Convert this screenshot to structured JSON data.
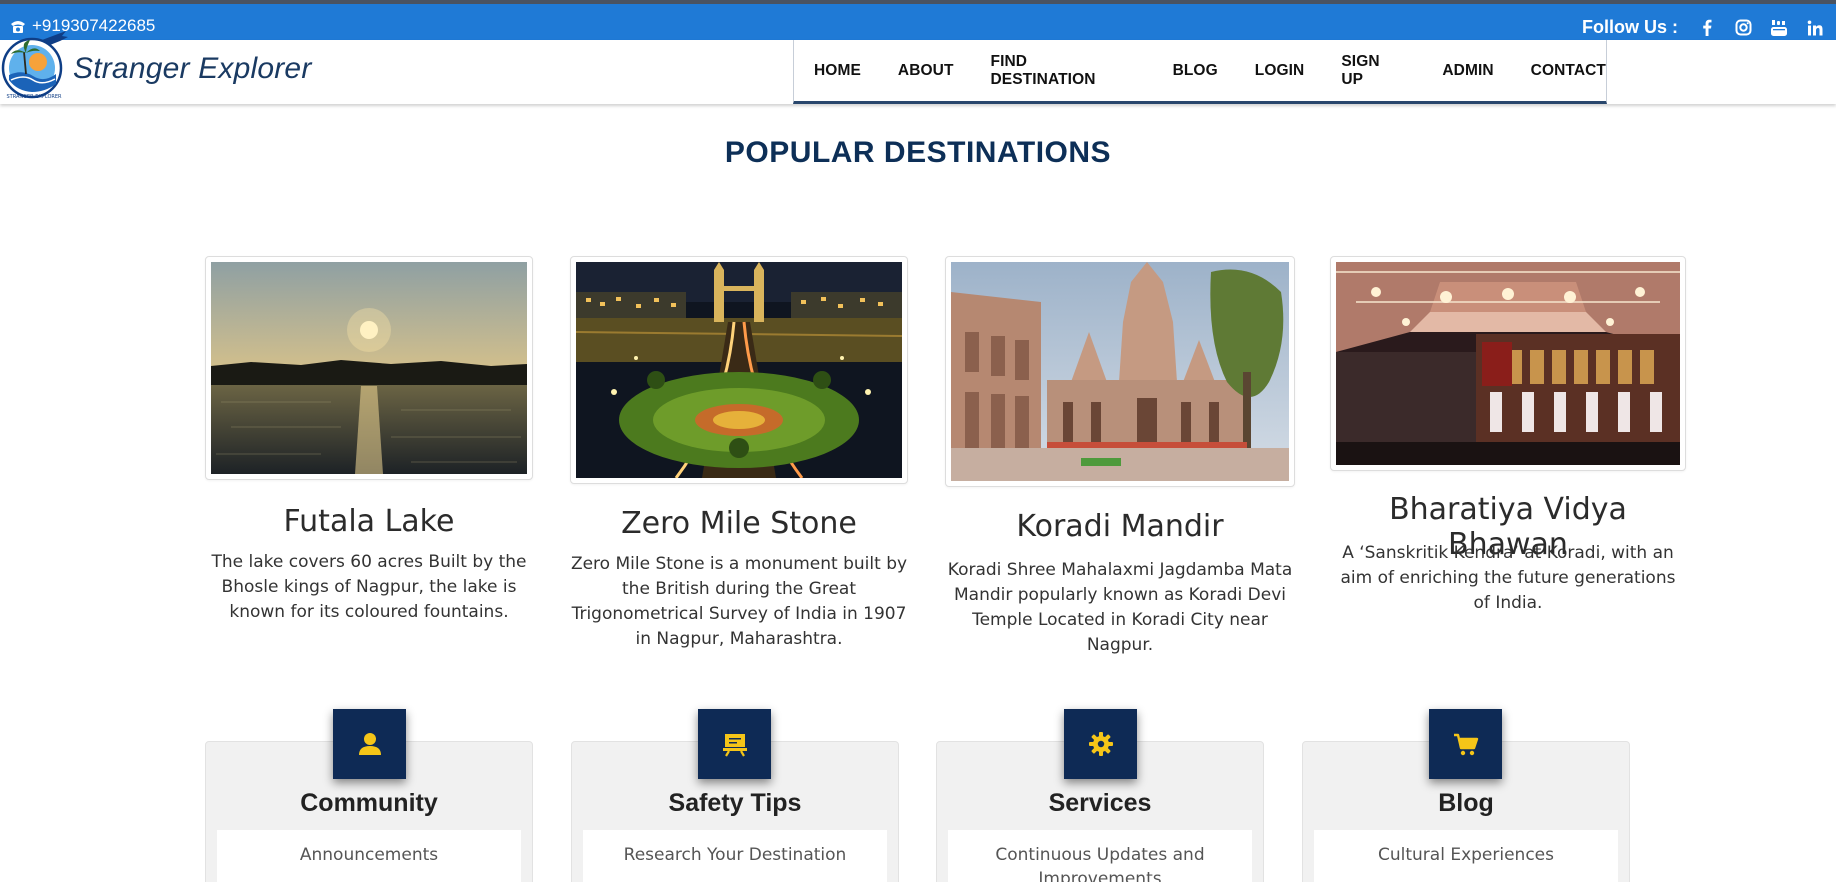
{
  "topbar": {
    "phone": "+919307422685",
    "follow_label": "Follow Us :",
    "social": [
      "facebook-icon",
      "instagram-icon",
      "youtube-icon",
      "linkedin-icon"
    ]
  },
  "brand": {
    "name": "Stranger Explorer",
    "logo_caption": "STRANGER EXPLORER"
  },
  "nav": {
    "items": [
      "HOME",
      "ABOUT",
      "FIND DESTINATION",
      "BLOG",
      "LOGIN",
      "SIGN UP",
      "ADMIN",
      "CONTACT"
    ]
  },
  "popular": {
    "title": "POPULAR DESTINATIONS",
    "items": [
      {
        "name": "Futala Lake",
        "desc": "The lake covers 60 acres Built by the Bhosle kings of Nagpur, the lake is known for its coloured fountains."
      },
      {
        "name": "Zero Mile Stone",
        "desc": "Zero Mile Stone is a monument built by the British during the Great Trigonometrical Survey of India in 1907 in Nagpur, Maharashtra."
      },
      {
        "name": "Koradi Mandir",
        "desc": "Koradi Shree Mahalaxmi Jagdamba Mata Mandir popularly known as Koradi Devi Temple Located in Koradi City near Nagpur."
      },
      {
        "name": "Bharatiya Vidya Bhawan",
        "desc": "A ‘Sanskritik Kendra’ at Koradi, with an aim of enriching the future generations of India."
      }
    ]
  },
  "features": [
    {
      "title": "Community",
      "text": "Announcements",
      "icon": "user-icon"
    },
    {
      "title": "Safety Tips",
      "text": "Research Your Destination",
      "icon": "presentation-icon"
    },
    {
      "title": "Services",
      "text": "Continuous Updates and Improvements",
      "icon": "gear-icon"
    },
    {
      "title": "Blog",
      "text": "Cultural Experiences",
      "icon": "cart-icon"
    }
  ],
  "colors": {
    "topbar": "#1f7ad6",
    "navy": "#0e2a55",
    "title": "#0d2f57",
    "icon_accent": "#f5c518"
  }
}
